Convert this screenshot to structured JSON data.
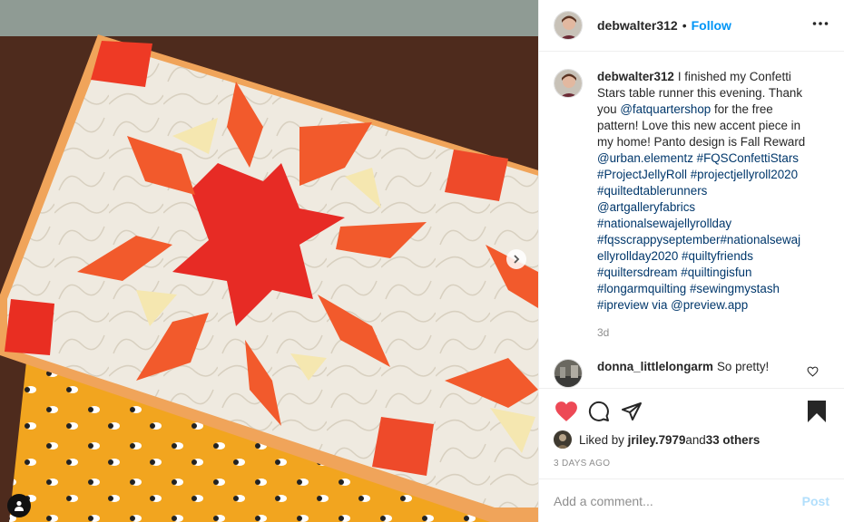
{
  "media": {
    "description_icon": "quilt-photo",
    "next_icon": "chevron-right-icon",
    "user_tag_icon": "person-icon"
  },
  "header": {
    "username": "debwalter312",
    "separator": "•",
    "follow_label": "Follow",
    "more_icon": "ellipsis-icon"
  },
  "caption": {
    "username": "debwalter312",
    "lines": [
      {
        "text": "I finished my Confetti"
      },
      {
        "text": "Stars table runner this evening. Thank"
      },
      {
        "text": "you "
      },
      {
        "text": "@fatquartershop"
      },
      {
        "text": " for the free"
      },
      {
        "text": "pattern! Love this new accent piece in"
      },
      {
        "text": "my home! Panto design is Fall Reward"
      },
      {
        "text": "@urban.elementz #FQSConfettiStars"
      },
      {
        "text": "#ProjectJellyRoll #projectjellyroll2020"
      },
      {
        "text": "#quiltedtablerunners"
      },
      {
        "text": "@artgalleryfabrics"
      },
      {
        "text": "#nationalsewajellyrollday"
      },
      {
        "text": "#fqsscrappyseptember#nationalsewaj"
      },
      {
        "text": "ellyrollday2020 #quiltyfriends"
      },
      {
        "text": "#quiltersdream #quiltingisfun"
      },
      {
        "text": "#longarmquilting #sewingmystash"
      },
      {
        "text": "#ipreview via "
      },
      {
        "text": "@preview.app"
      }
    ],
    "time": "3d"
  },
  "comment": {
    "username": "donna_littlelongarm",
    "text": "So pretty!",
    "like_icon": "heart-outline-icon"
  },
  "actions": {
    "like_icon": "heart-filled-icon",
    "comment_icon": "speech-bubble-icon",
    "share_icon": "paper-plane-icon",
    "save_icon": "bookmark-filled-icon",
    "like_color": "#ed4956"
  },
  "likes": {
    "prefix": "Liked by ",
    "user": "jriley.7979",
    "middle": " and ",
    "others": "33 others"
  },
  "date": "3 DAYS AGO",
  "add_comment": {
    "placeholder": "Add a comment...",
    "post_label": "Post"
  }
}
